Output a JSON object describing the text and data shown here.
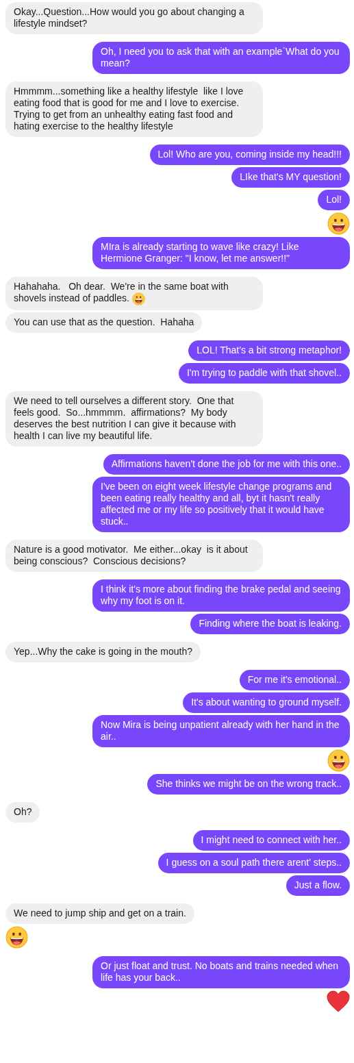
{
  "groups": [
    {
      "outgoing": false,
      "messages": [
        {
          "kind": "text",
          "text": "Okay...Question...How would you go about changing a lifestyle mindset?"
        }
      ]
    },
    {
      "outgoing": true,
      "messages": [
        {
          "kind": "text",
          "text": "Oh, I need you to ask that with an example`What do you mean?"
        }
      ]
    },
    {
      "outgoing": false,
      "messages": [
        {
          "kind": "text",
          "text": "Hmmmm...something like a healthy lifestyle  like I love eating food that is good for me and I love to exercise.  Trying to get from an unhealthy eating fast food and hating exercise to the healthy lifestyle"
        }
      ]
    },
    {
      "outgoing": true,
      "messages": [
        {
          "kind": "text",
          "text": "Lol! Who are you, coming inside my head!!!"
        },
        {
          "kind": "text",
          "text": "LIke that's MY question!"
        },
        {
          "kind": "text",
          "text": "Lol!"
        },
        {
          "kind": "smiley"
        },
        {
          "kind": "text",
          "text": "MIra is already starting to wave like crazy! Like Hermione Granger: \"I know, let me answer!!\""
        }
      ]
    },
    {
      "outgoing": false,
      "messages": [
        {
          "kind": "text",
          "text": "Hahahaha.   Oh dear.  We're in the same boat with shovels instead of paddles. ",
          "emoji": true
        },
        {
          "kind": "text",
          "text": "You can use that as the question.  Hahaha"
        }
      ]
    },
    {
      "outgoing": true,
      "messages": [
        {
          "kind": "text",
          "text": "LOL! That's a bit strong metaphor!"
        },
        {
          "kind": "text",
          "text": "I'm trying to paddle with that shovel.."
        }
      ]
    },
    {
      "outgoing": false,
      "messages": [
        {
          "kind": "text",
          "text": "We need to tell ourselves a different story.  One that feels good.  So...hmmmm.  affirmations?  My body deserves the best nutrition I can give it because with health I can live my beautiful life."
        }
      ]
    },
    {
      "outgoing": true,
      "messages": [
        {
          "kind": "text",
          "text": "Affirmations haven't done the job for me with this one.."
        },
        {
          "kind": "text",
          "text": "I've been on eight week lifestyle change programs and been eating really healthy and all, byt it hasn't really affected me or my life so positively that it would have stuck.."
        }
      ]
    },
    {
      "outgoing": false,
      "messages": [
        {
          "kind": "text",
          "text": "Nature is a good motivator.  Me either...okay  is it about being conscious?  Conscious decisions?"
        }
      ]
    },
    {
      "outgoing": true,
      "messages": [
        {
          "kind": "text",
          "text": "I think it's more about finding the brake pedal and seeing why my foot is on it."
        },
        {
          "kind": "text",
          "text": "Finding where the boat is leaking."
        }
      ]
    },
    {
      "outgoing": false,
      "messages": [
        {
          "kind": "text",
          "text": "Yep...Why the cake is going in the mouth?"
        }
      ]
    },
    {
      "outgoing": true,
      "messages": [
        {
          "kind": "text",
          "text": "For me it's emotional.."
        },
        {
          "kind": "text",
          "text": "It's about wanting to ground myself."
        },
        {
          "kind": "text",
          "text": "Now Mira is being unpatient already with her hand in the air.."
        },
        {
          "kind": "smiley"
        },
        {
          "kind": "text",
          "text": "She thinks we might be on the wrong track.."
        }
      ]
    },
    {
      "outgoing": false,
      "messages": [
        {
          "kind": "text",
          "text": "Oh?"
        }
      ]
    },
    {
      "outgoing": true,
      "messages": [
        {
          "kind": "text",
          "text": "I might need to connect with her.."
        },
        {
          "kind": "text",
          "text": "I guess on a soul path there arent' steps.."
        },
        {
          "kind": "text",
          "text": "Just a flow."
        }
      ]
    },
    {
      "outgoing": false,
      "messages": [
        {
          "kind": "text",
          "text": "We need to jump ship and get on a train."
        },
        {
          "kind": "smiley"
        }
      ]
    },
    {
      "outgoing": true,
      "messages": [
        {
          "kind": "text",
          "text": "Or just float and trust. No boats and trains needed when life has your back.."
        },
        {
          "kind": "heart"
        }
      ]
    }
  ]
}
